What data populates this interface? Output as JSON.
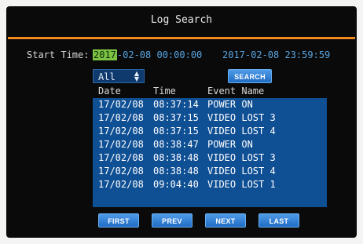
{
  "title": "Log Search",
  "start_time": {
    "label": "Start Time:",
    "start_highlight": "2017",
    "start_rest": "-02-08 00:00:00",
    "end": "2017-02-08 23:59:59"
  },
  "filter": {
    "selected": "All"
  },
  "search_label": "SEARCH",
  "columns": [
    "Date",
    "Time",
    "Event Name"
  ],
  "rows": [
    {
      "date": "17/02/08",
      "time": "08:37:14",
      "event": "POWER ON"
    },
    {
      "date": "17/02/08",
      "time": "08:37:15",
      "event": "VIDEO LOST 3"
    },
    {
      "date": "17/02/08",
      "time": "08:37:15",
      "event": "VIDEO LOST 4"
    },
    {
      "date": "17/02/08",
      "time": "08:38:47",
      "event": "POWER ON"
    },
    {
      "date": "17/02/08",
      "time": "08:38:48",
      "event": "VIDEO LOST 3"
    },
    {
      "date": "17/02/08",
      "time": "08:38:48",
      "event": "VIDEO LOST 4"
    },
    {
      "date": "17/02/08",
      "time": "09:04:40",
      "event": "VIDEO LOST 1"
    }
  ],
  "nav": {
    "first": "FIRST",
    "prev": "PREV",
    "next": "NEXT",
    "last": "LAST"
  },
  "colors": {
    "accent_orange": "#f08a1c",
    "highlight_green": "#7cc243",
    "list_blue": "#0f4f94",
    "button_blue": "#2f7fd6"
  }
}
